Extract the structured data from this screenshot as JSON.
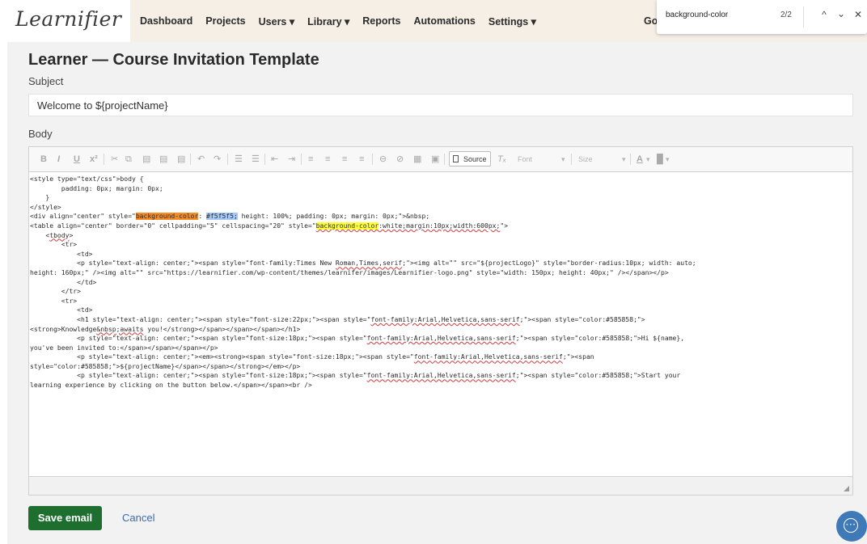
{
  "app": {
    "logo": "Learnifier"
  },
  "nav": {
    "items": [
      "Dashboard",
      "Projects",
      "Users ▾",
      "Library ▾",
      "Reports",
      "Automations",
      "Settings ▾"
    ],
    "partial_item": "Go"
  },
  "find": {
    "query": "background-color",
    "count": "2/2",
    "prev_label": "^",
    "next_label": "⌄",
    "close_label": "✕"
  },
  "page_title": "Learner — Course Invitation Template",
  "subject": {
    "label": "Subject",
    "value": "Welcome to ${projectName}"
  },
  "body": {
    "label": "Body"
  },
  "toolbar": {
    "bold": "B",
    "italic": "I",
    "underline": "U",
    "superscript": "x²",
    "source_label": "Source",
    "clear_format": "Tₓ",
    "font_placeholder": "Font",
    "size_placeholder": "Size",
    "text_color": "A",
    "bg_color": "█"
  },
  "code_lines": [
    "<style type=\"text/css\">body {",
    "        padding: 0px; margin: 0px;",
    "    }",
    "</style>",
    "<div align=\"center\" style=\"",
    "<table align=\"center\" border=\"0\" cellpadding=\"5\" cellspacing=\"20\" style=\"",
    "    <",
    "        <tr>",
    "            <td>",
    "            <p style=\"text-align: center;\"><span style=\"font-family:Times New ",
    "height: 160px;\" /><img alt=\"\" src=\"https://learnifier.com/wp-content/themes/learnifer/images/Learnifier-logo.png\" style=\"width: 150px; height: 40px;\" /></span></p>",
    "            </td>",
    "        </tr>",
    "        <tr>",
    "            <td>",
    "            <h1 style=\"text-align: center;\"><span style=\"font-size:22px;\"><span style=\"",
    "<strong>Knowledge",
    "",
    "            <p style=\"text-align: center;\"><span style=\"font-size:18px;\"><span style=\"",
    "you've been invited to:</span></span></span></p>",
    "",
    "            <p style=\"text-align: center;\"><em><strong><span style=\"font-size:18px;\"><span style=\"",
    "style=\"color:#585858;\">${projectName}</span></span></strong></em></p>",
    "",
    "            <p style=\"text-align: center;\"><span style=\"font-size:18px;\"><span style=\"",
    "learning experience by clicking on the button below.</span></span><br />"
  ],
  "code_frag": {
    "div_match": "background-color",
    "div_colon": ": ",
    "div_value": "#f5f5f5;",
    "div_rest": " height: 100%; padding: 0px; margin: 0px;\">&nbsp;",
    "table_match": "background-color",
    "table_rest_wavy": ":white;margin:10px;width:600px;",
    "table_end": "\">",
    "tbody": "tbody",
    "tbody_end": ">",
    "img_wavy": "Roman,Times,serif",
    "img_rest": ";\"><img alt=\"\" src=\"${projectLogo}\" style=\"border-radius:10px; width: auto;",
    "ff_wavy": "font-family:Arial,Helvetica,sans-serif",
    "h1_rest": ";\"><span style=\"color:#585858;\">",
    "h1_wavy": "&nbsp;awaits",
    "h1_end": " you!</strong></span></span></span></h1>",
    "p1_rest": ";\"><span style=\"color:#585858;\">Hi ${name},",
    "p2_rest": ";\"><span",
    "p3_rest": ";\"><span style=\"color:#585858;\">Start your"
  },
  "actions": {
    "save": "Save email",
    "cancel": "Cancel"
  },
  "colors": {
    "save_bg": "#1e6f2f",
    "link": "#3d6aa8",
    "nav_bg": "#f6efe6",
    "highlight_current": "#f28c28",
    "highlight_match": "#ffff3c"
  }
}
